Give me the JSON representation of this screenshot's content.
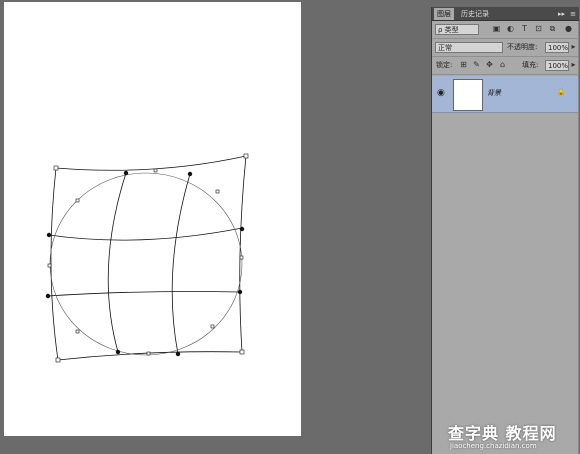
{
  "panel": {
    "tabs": [
      "图层",
      "历史记录"
    ],
    "collapse_glyph": "▸▸",
    "menu_glyph": "≡",
    "filter": {
      "kind_label": "ρ 类型",
      "icons": [
        "image-filter-icon",
        "adjustment-filter-icon",
        "type-filter-icon",
        "shape-filter-icon",
        "smart-object-filter-icon"
      ]
    },
    "blend": {
      "mode": "正常",
      "opacity_label": "不透明度:",
      "opacity_value": "100%"
    },
    "lock": {
      "label": "锁定:",
      "icons": [
        "lock-transparent-icon",
        "lock-paint-icon",
        "lock-position-icon",
        "lock-all-icon"
      ],
      "fill_label": "填充:",
      "fill_value": "100%"
    },
    "layers": [
      {
        "name": "背景",
        "visible": true,
        "locked": true
      }
    ]
  },
  "watermark": {
    "main": "查字典 教程网",
    "url": "jiaocheng.chazidian.com"
  }
}
